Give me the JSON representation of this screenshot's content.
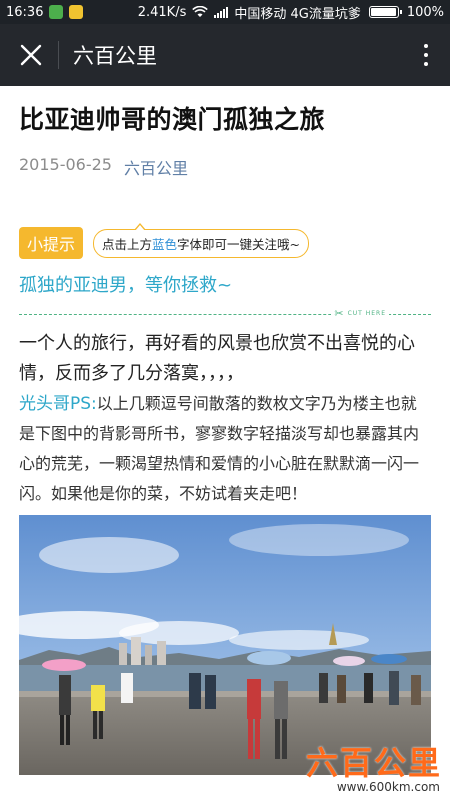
{
  "status_bar": {
    "time": "16:36",
    "speed": "2.41K/s",
    "carrier": "中国移动 4G流量坑爹",
    "battery": "100%"
  },
  "nav": {
    "title": "六百公里",
    "close_icon": "close-icon",
    "more_icon": "more-vertical-icon"
  },
  "article": {
    "title": "比亚迪帅哥的澳门孤独之旅",
    "date": "2015-06-25",
    "account": "六百公里",
    "tip_badge": "小提示",
    "tip_text_before": "点击上方",
    "tip_text_blue": "蓝色",
    "tip_text_after": "字体即可一键关注哦~",
    "subtitle": "孤独的亚迪男，等你拯救~",
    "cut_here": "CUT HERE",
    "paragraph1": "一个人的旅行，再好看的风景也欣赏不出喜悦的心情，反而多了几分落寞，，，，",
    "ps_label": "光头哥PS:",
    "ps_text": "以上几颗逗号间散落的数枚文字乃为楼主也就是下图中的背影哥所书，寥寥数字轻描淡写却也暴露其内心的荒芜，一颗渴望热情和爱情的小心脏在默默滴一闪一闪。如果他是你的菜，不妨试着夹走吧！"
  },
  "watermark": {
    "logo": "六百公里",
    "url": "www.600km.com"
  },
  "colors": {
    "nav_bg": "#25282d",
    "tip_yellow": "#f5b82e",
    "accent_blue": "#2ea7c9",
    "link_blue": "#607fa6",
    "cut_green": "#4fb384"
  }
}
